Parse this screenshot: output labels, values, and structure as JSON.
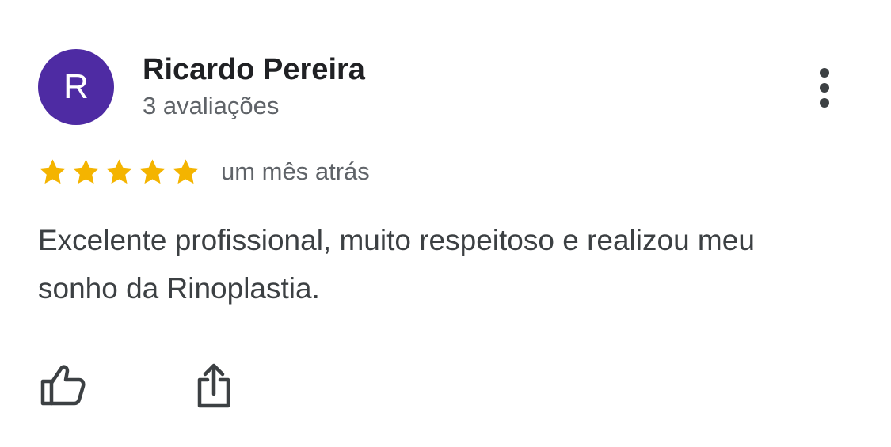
{
  "reviewer": {
    "initial": "R",
    "name": "Ricardo Pereira",
    "review_count": "3 avaliações",
    "avatar_color": "#4e2ba3"
  },
  "rating": {
    "stars": 5,
    "max_stars": 5,
    "star_color": "#f4b400",
    "date": "um mês atrás"
  },
  "review": {
    "text": "Excelente profissional, muito respeitoso e realizou meu sonho da Rinoplastia."
  },
  "actions": {
    "more_icon": "more-vert-icon",
    "like_icon": "thumb-up-icon",
    "share_icon": "share-icon"
  }
}
